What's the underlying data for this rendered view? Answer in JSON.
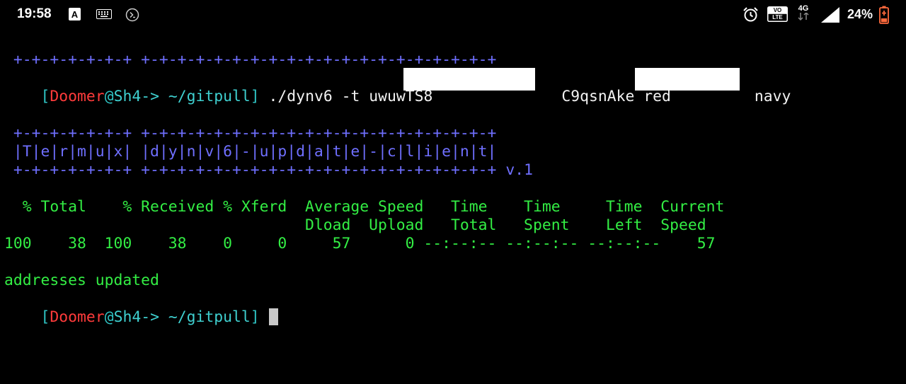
{
  "status_bar": {
    "time": "19:58",
    "icons_left": [
      "a-box-icon",
      "keyboard-icon",
      "terminal-icon"
    ],
    "icons_right": [
      "alarm-icon",
      "volte-icon",
      "4g-icon",
      "signal-icon",
      "battery-icon"
    ],
    "volte_label_top": "VO",
    "volte_label_bottom": "LTE",
    "network": "4G",
    "battery": "24%"
  },
  "terminal": {
    "banner_border_1": " +-+-+-+-+-+-+ +-+-+-+-+-+-+-+-+-+-+-+-+-+-+-+-+-+-+-+",
    "prompt": {
      "open": "[",
      "user": "Doomer",
      "at": "@",
      "host": "Sh4->",
      "path": " ~/gitpull",
      "close": "]"
    },
    "command_part1": " ./dynv6 -t uwuwTS8",
    "command_part2": "C9qsnAke red",
    "command_part3": "navy",
    "logo_border_top": " +-+-+-+-+-+-+ +-+-+-+-+-+-+-+-+-+-+-+-+-+-+-+-+-+-+-+",
    "logo_text": " |T|e|r|m|u|x| |d|y|n|v|6|-|u|p|d|a|t|e|-|c|l|i|e|n|t|",
    "logo_border_bottom": " +-+-+-+-+-+-+ +-+-+-+-+-+-+-+-+-+-+-+-+-+-+-+-+-+-+-+",
    "version": " v.1",
    "curl_header_1": "  % Total    % Received % Xferd  Average Speed   Time    Time     Time  Current",
    "curl_header_2": "                                 Dload  Upload   Total   Spent    Left  Speed",
    "curl_values": "100    38  100    38    0     0     57      0 --:--:-- --:--:-- --:--:--    57",
    "result": "addresses updated"
  },
  "colors": {
    "background": "#000000",
    "banner": "#6f6fff",
    "output": "#33ee44",
    "user": "#ff3b3b",
    "path": "#2fc4c4"
  }
}
